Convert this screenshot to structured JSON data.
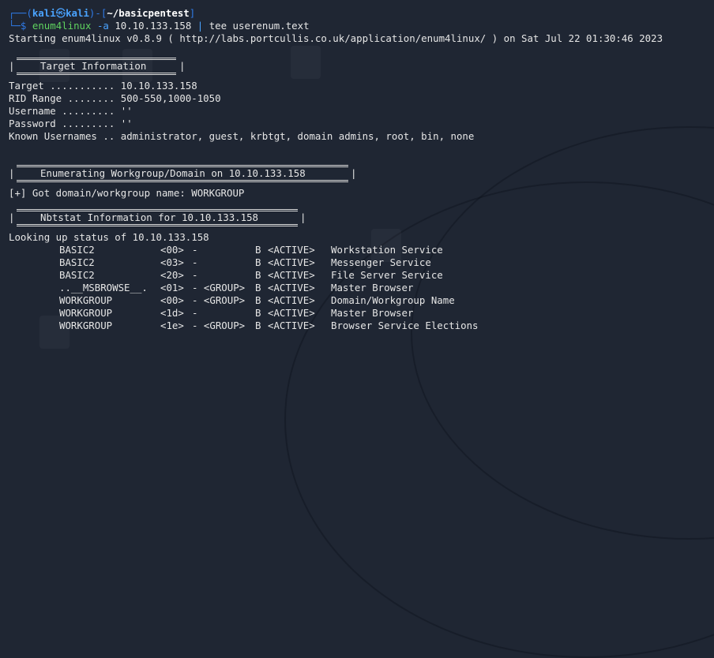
{
  "prompt": {
    "open": "┌──(",
    "user": "kali",
    "at": "㉿",
    "host": "kali",
    "mid": ")-[",
    "path": "~/basicpentest",
    "close": "]",
    "arrow": "└─$",
    "cmd": "enum4linux",
    "flag": "-a",
    "ip": "10.10.133.158",
    "pipe": "|",
    "cmd2": "tee userenum.text"
  },
  "starting_line": "Starting enum4linux v0.8.9 ( http://labs.portcullis.co.uk/application/enum4linux/ ) on Sat Jul 22 01:30:46 2023",
  "sections": {
    "target_header": "Target Information",
    "target_lines": [
      "Target ........... 10.10.133.158",
      "RID Range ........ 500-550,1000-1050",
      "Username ......... ''",
      "Password ......... ''",
      "Known Usernames .. administrator, guest, krbtgt, domain admins, root, bin, none"
    ],
    "workgroup_header": "Enumerating Workgroup/Domain on 10.10.133.158",
    "workgroup_line": "[+] Got domain/workgroup name: WORKGROUP",
    "nbstat_header": "Nbtstat Information for 10.10.133.158",
    "lookup_line": "Looking up status of 10.10.133.158"
  },
  "nbstat_rows": [
    {
      "name": "BASIC2",
      "code": "<00>",
      "group": "-",
      "flag": "B",
      "state": "<ACTIVE>",
      "desc": "Workstation Service"
    },
    {
      "name": "BASIC2",
      "code": "<03>",
      "group": "-",
      "flag": "B",
      "state": "<ACTIVE>",
      "desc": "Messenger Service"
    },
    {
      "name": "BASIC2",
      "code": "<20>",
      "group": "-",
      "flag": "B",
      "state": "<ACTIVE>",
      "desc": "File Server Service"
    },
    {
      "name": "..__MSBROWSE__.",
      "code": "<01>",
      "group": "- <GROUP>",
      "flag": "B",
      "state": "<ACTIVE>",
      "desc": "Master Browser"
    },
    {
      "name": "WORKGROUP",
      "code": "<00>",
      "group": "- <GROUP>",
      "flag": "B",
      "state": "<ACTIVE>",
      "desc": "Domain/Workgroup Name"
    },
    {
      "name": "WORKGROUP",
      "code": "<1d>",
      "group": "-",
      "flag": "B",
      "state": "<ACTIVE>",
      "desc": "Master Browser"
    },
    {
      "name": "WORKGROUP",
      "code": "<1e>",
      "group": "- <GROUP>",
      "flag": "B",
      "state": "<ACTIVE>",
      "desc": "Browser Service Elections"
    }
  ],
  "colors": {
    "background": "#1f2633",
    "prompt_blue": "#4aa3ff",
    "prompt_frame": "#2f7ae5",
    "text": "#e6e6e6"
  }
}
